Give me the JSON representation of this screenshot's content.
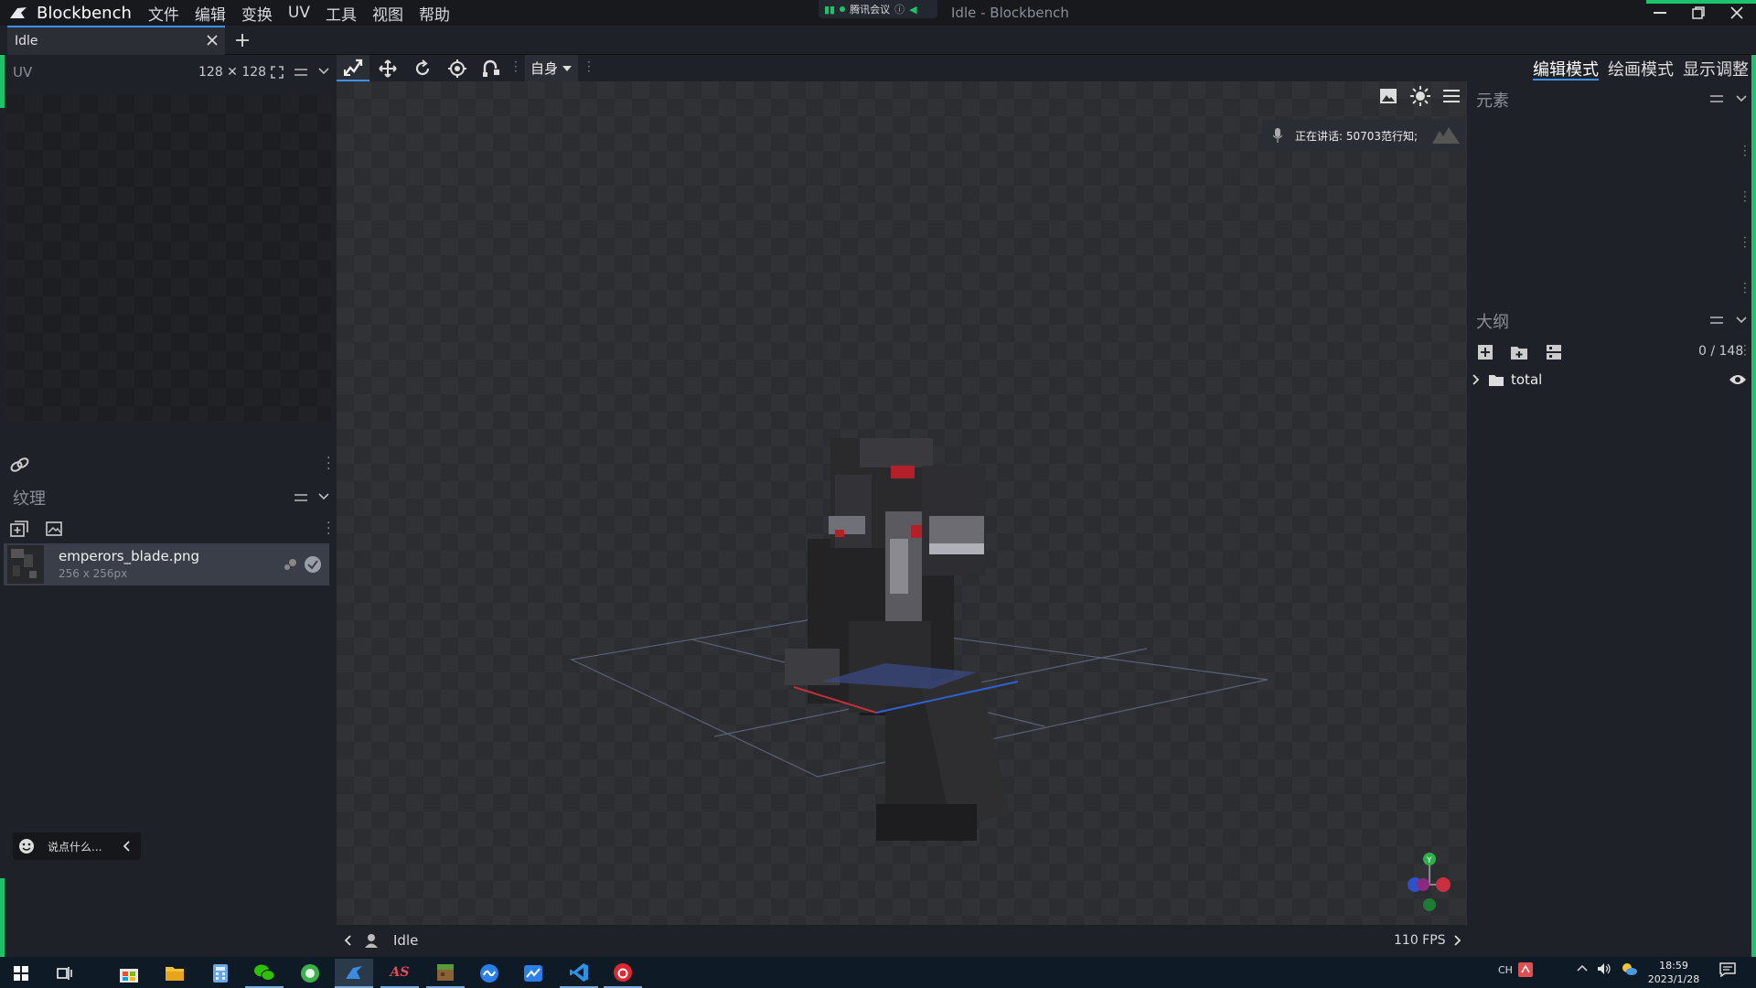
{
  "app": {
    "name": "Blockbench",
    "window_title": "Idle - Blockbench",
    "menu": [
      "文件",
      "编辑",
      "变换",
      "UV",
      "工具",
      "视图",
      "帮助"
    ],
    "meeting_label": "腾讯会议"
  },
  "tabs": [
    {
      "label": "Idle"
    }
  ],
  "uv_panel": {
    "label": "UV",
    "size": "128 ✕ 128"
  },
  "toolbar": {
    "space_select": "自身"
  },
  "modes": [
    "编辑模式",
    "绘画模式",
    "显示调整"
  ],
  "elements_panel": {
    "title": "元素"
  },
  "outliner": {
    "title": "大纲",
    "count": "0 / 148",
    "items": [
      {
        "label": "total"
      }
    ]
  },
  "textures": {
    "title": "纹理",
    "items": [
      {
        "name": "emperors_blade.png",
        "size": "256 x 256px"
      }
    ]
  },
  "chat": {
    "placeholder": "说点什么..."
  },
  "speaking": {
    "text": "正在讲话: 50703范行知;"
  },
  "statusbar": {
    "animation": "Idle",
    "fps": "110 FPS"
  },
  "taskbar": {
    "lang": "CH",
    "time": "18:59",
    "date": "2023/1/28"
  },
  "colors": {
    "accent": "#3e90ff",
    "brand_green": "#1ec26a",
    "bg": "#1e2127",
    "panel": "#24272d"
  },
  "icons": [
    "blockbench-logo",
    "close-icon",
    "plus-icon",
    "fullscreen-icon",
    "menu-icon",
    "chevron-down-icon",
    "move-icon",
    "rotate-icon",
    "pivot-icon",
    "vertex-snap-icon",
    "image-icon",
    "sun-icon",
    "link-icon",
    "folder-icon",
    "eye-icon",
    "windows-start-icon",
    "mic-icon"
  ]
}
